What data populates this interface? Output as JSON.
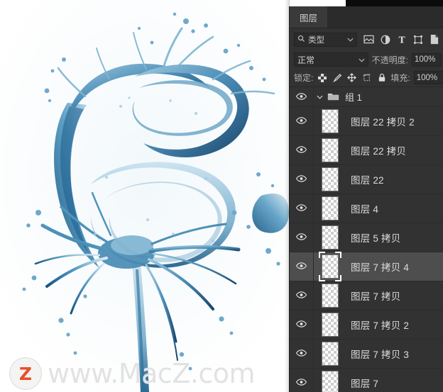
{
  "artwork": {
    "subject": "water-splash-rose",
    "background_color": "#ffffff",
    "water_color_dark": "#1d5f8f",
    "water_color_mid": "#5fa3c9",
    "water_color_light": "#bfdcea"
  },
  "watermark": {
    "logo_letter": "Z",
    "logo_color": "#e8502a",
    "text": "www.MacZ.com",
    "text_color": "#e2e2e2"
  },
  "panel": {
    "tabs": [
      {
        "label": "图层",
        "active": true
      }
    ],
    "filter": {
      "search_icon": "search-icon",
      "type_label": "类型",
      "chevron": "chevron-down-icon",
      "icons": [
        {
          "name": "pixel-layer-filter-icon",
          "glyph": "image"
        },
        {
          "name": "adjustment-layer-filter-icon",
          "glyph": "half-circle"
        },
        {
          "name": "type-layer-filter-icon",
          "glyph": "T"
        },
        {
          "name": "shape-layer-filter-icon",
          "glyph": "shape"
        },
        {
          "name": "smart-object-filter-icon",
          "glyph": "smart-object"
        }
      ]
    },
    "blend": {
      "mode": "正常",
      "chevron": "chevron-down-icon",
      "opacity_label": "不透明度:",
      "opacity_value": "100%"
    },
    "lock": {
      "label": "锁定:",
      "icons": [
        {
          "name": "lock-transparent-pixels-icon"
        },
        {
          "name": "lock-image-pixels-icon"
        },
        {
          "name": "lock-position-icon"
        },
        {
          "name": "lock-artboard-nesting-icon"
        },
        {
          "name": "lock-all-icon"
        }
      ],
      "fill_label": "填充:",
      "fill_value": "100%"
    },
    "group": {
      "name": "组 1",
      "expanded": true,
      "visible": true
    },
    "layers": [
      {
        "name": "图层 22 拷贝 2",
        "visible": true,
        "selected": false
      },
      {
        "name": "图层 22 拷贝",
        "visible": true,
        "selected": false
      },
      {
        "name": "图层 22",
        "visible": true,
        "selected": false
      },
      {
        "name": "图层 4",
        "visible": true,
        "selected": false
      },
      {
        "name": "图层 5 拷贝",
        "visible": true,
        "selected": false
      },
      {
        "name": "图层 7 拷贝 4",
        "visible": true,
        "selected": true
      },
      {
        "name": "图层 7 拷贝",
        "visible": true,
        "selected": false
      },
      {
        "name": "图层 7 拷贝 2",
        "visible": true,
        "selected": false
      },
      {
        "name": "图层 7 拷贝 3",
        "visible": true,
        "selected": false
      },
      {
        "name": "图层 7",
        "visible": true,
        "selected": false
      }
    ]
  }
}
